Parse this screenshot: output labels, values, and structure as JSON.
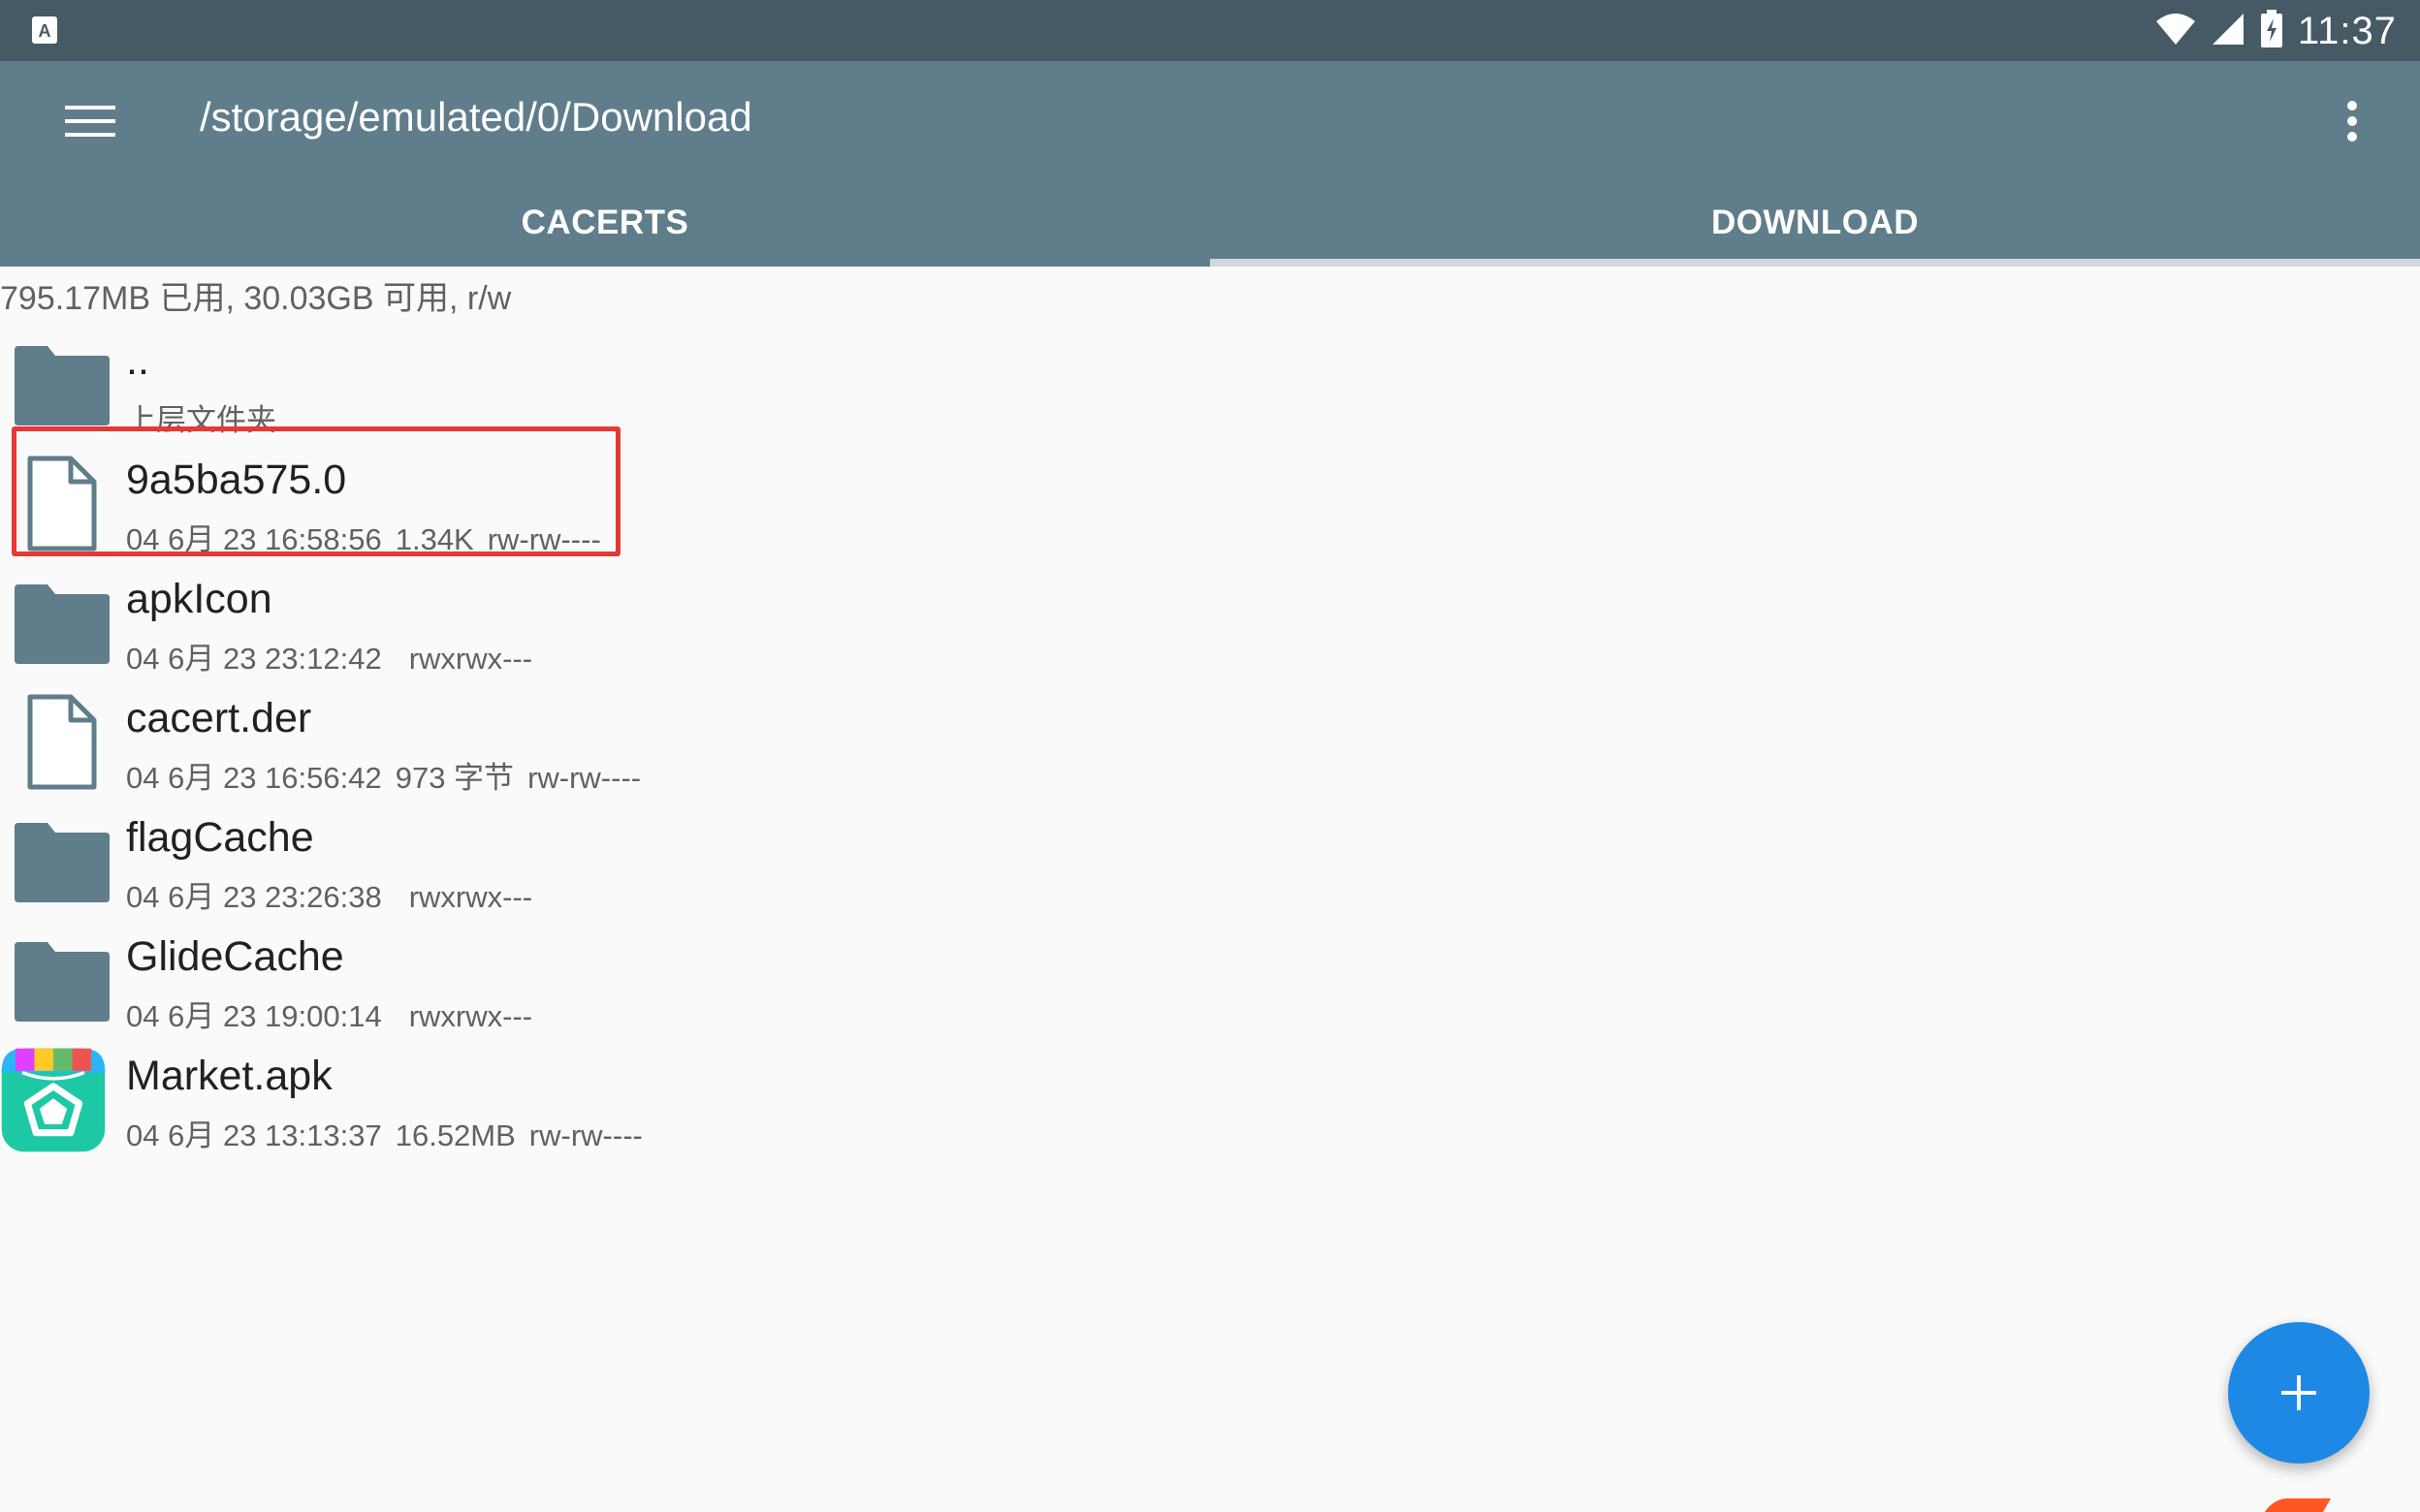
{
  "status_bar": {
    "time": "11:37",
    "left_icon": "a-keyboard-icon",
    "icons": [
      "wifi-icon",
      "signal-icon",
      "battery-charging-icon"
    ],
    "color": "#455a64"
  },
  "app_bar": {
    "path": "/storage/emulated/0/Download",
    "color": "#607d8b",
    "tabs": [
      {
        "label": "CACERTS",
        "active": false
      },
      {
        "label": "DOWNLOAD",
        "active": true
      }
    ]
  },
  "storage_info": "795.17MB 已用, 30.03GB 可用, r/w",
  "files": [
    {
      "name": "..",
      "subtitle": "上层文件夹",
      "type": "folder",
      "icon": "folder-icon"
    },
    {
      "name": "9a5ba575.0",
      "date": "04 6月 23 16:58:56",
      "size": "1.34K",
      "perm": "rw-rw----",
      "type": "file",
      "icon": "file-icon",
      "highlighted": true
    },
    {
      "name": "apkIcon",
      "date": "04 6月 23 23:12:42",
      "size": "",
      "perm": "rwxrwx---",
      "type": "folder",
      "icon": "folder-icon"
    },
    {
      "name": "cacert.der",
      "date": "04 6月 23 16:56:42",
      "size": "973 字节",
      "perm": "rw-rw----",
      "type": "file",
      "icon": "file-icon"
    },
    {
      "name": "flagCache",
      "date": "04 6月 23 23:26:38",
      "size": "",
      "perm": "rwxrwx---",
      "type": "folder",
      "icon": "folder-icon"
    },
    {
      "name": "GlideCache",
      "date": "04 6月 23 19:00:14",
      "size": "",
      "perm": "rwxrwx---",
      "type": "folder",
      "icon": "folder-icon"
    },
    {
      "name": "Market.apk",
      "date": "04 6月 23 13:13:37",
      "size": "16.52MB",
      "perm": "rw-rw----",
      "type": "apk",
      "icon": "market-app-icon"
    }
  ],
  "fab": {
    "icon": "plus-icon",
    "color": "#1e88e5"
  },
  "highlight_color": "#e53935"
}
